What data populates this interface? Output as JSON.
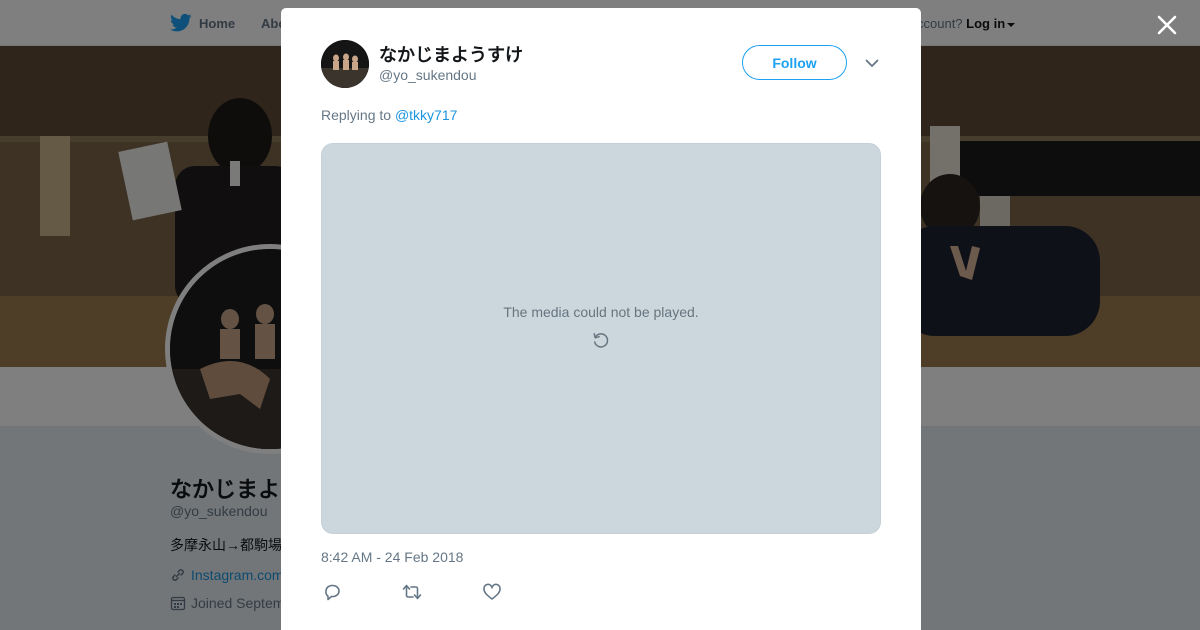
{
  "nav": {
    "home_label": "Home",
    "about_label": "Abo",
    "account_prompt": "ccount?",
    "login_label": "Log in"
  },
  "profile": {
    "name": "なかじまよ",
    "handle": "@yo_sukendou",
    "bio": "多摩永山→都駒場",
    "link": "Instagram.com",
    "joined": "Joined Septem"
  },
  "tweet": {
    "author_name": "なかじまようすけ",
    "author_handle": "@yo_sukendou",
    "follow_label": "Follow",
    "replying_prefix": "Replying to",
    "replying_to": "@tkky717",
    "media_error": "The media could not be played.",
    "timestamp": "8:42 AM - 24 Feb 2018"
  },
  "icons": {
    "close": "close-icon",
    "more": "chevron-down-icon",
    "retry": "retry-icon",
    "reply": "reply-icon",
    "retweet": "retweet-icon",
    "like": "heart-icon",
    "brand": "twitter-bird-icon",
    "link": "link-icon",
    "calendar": "calendar-icon"
  },
  "colors": {
    "accent": "#1da1f2",
    "link": "#1b95e0",
    "secondary_text": "#657786",
    "media_placeholder": "#ccd6dd"
  }
}
